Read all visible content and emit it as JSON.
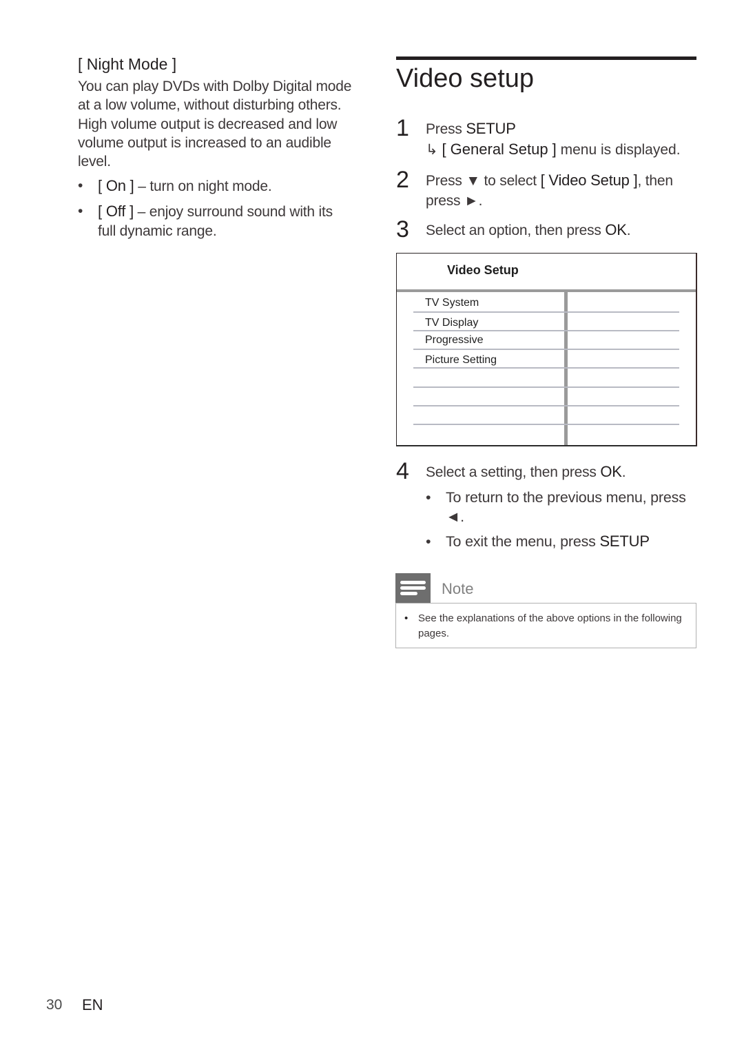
{
  "left": {
    "heading": "[ Night Mode ]",
    "paragraph": "You can play DVDs with Dolby Digital mode at a low volume, without disturbing others. High volume output is decreased and low volume output is increased to an audible level.",
    "options": [
      {
        "bullet": "•",
        "label": "[ On ]",
        "desc": " – turn on night mode."
      },
      {
        "bullet": "•",
        "label": "[ Off ]",
        "desc": " – enjoy surround sound with its full dynamic range."
      }
    ]
  },
  "right": {
    "title": "Video setup",
    "steps": [
      {
        "num": "1",
        "pre": "Press ",
        "key": "SETUP",
        "post": "",
        "result_arrow": "↳",
        "result_key": "[ General Setup ]",
        "result_post": "menu is displayed."
      },
      {
        "num": "2",
        "pre": "Press ▼ to select ",
        "key": "[ Video Setup ]",
        "post": ", then press ►."
      },
      {
        "num": "3",
        "pre": "Select an option, then press ",
        "key": "OK",
        "post": "."
      },
      {
        "num": "4",
        "pre": "Select a setting, then press ",
        "key": "OK",
        "post": "."
      }
    ],
    "step4_bullets": [
      {
        "bullet": "•",
        "text": "To return to the previous menu, press ◄."
      },
      {
        "bullet": "•",
        "text": "To exit the menu, press ",
        "key": "SETUP"
      }
    ],
    "menu": {
      "title": "Video Setup",
      "items": [
        "TV System",
        "TV Display",
        "Progressive",
        "Picture Setting"
      ],
      "empty_rows": 4
    },
    "note": {
      "label": "Note",
      "bullet": "•",
      "text": "See the explanations of the above options in the following pages."
    }
  },
  "footer": {
    "page_number": "30",
    "language": "EN"
  }
}
